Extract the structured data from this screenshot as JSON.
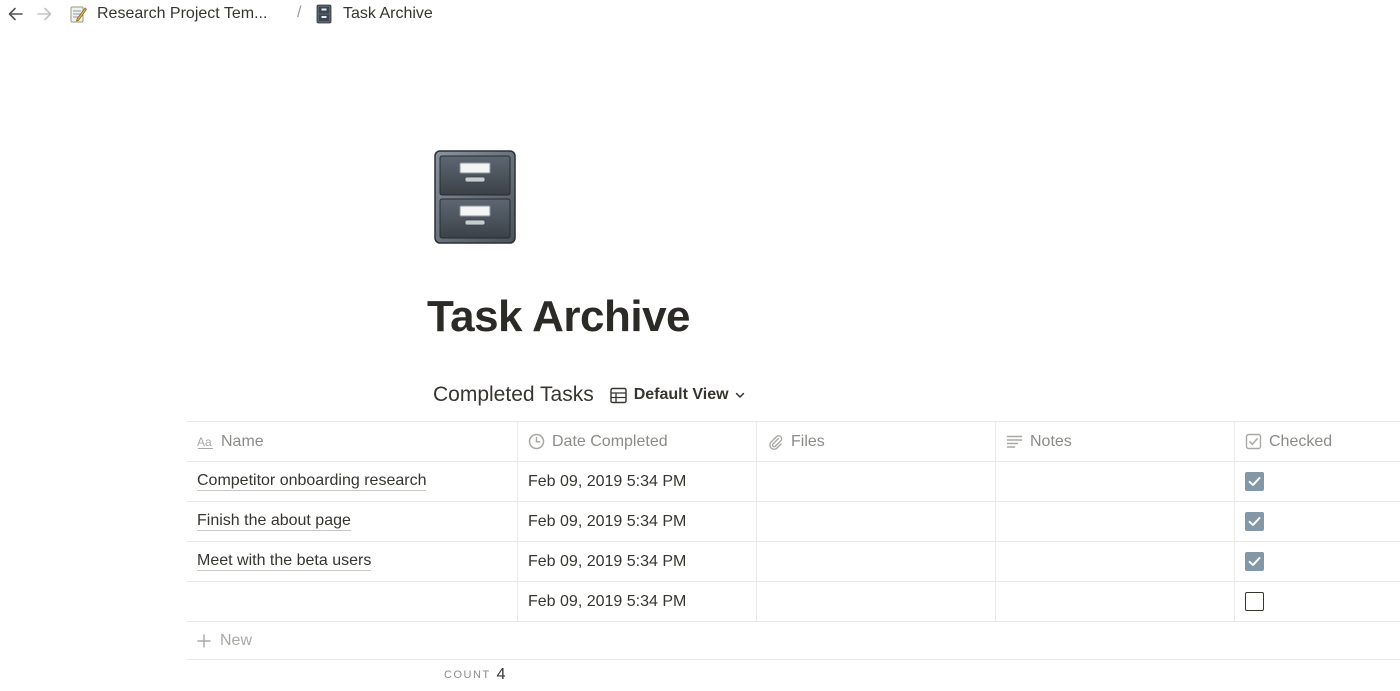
{
  "breadcrumb": {
    "items": [
      {
        "label": "Research Project Tem...",
        "icon": "memo-icon"
      },
      {
        "label": "Task Archive",
        "icon": "file-cabinet-icon"
      }
    ],
    "separator": "/"
  },
  "page": {
    "icon": "file-cabinet-icon",
    "title": "Task Archive"
  },
  "database": {
    "title": "Completed Tasks",
    "view_label": "Default View",
    "columns": [
      {
        "label": "Name",
        "icon": "text-aa-icon"
      },
      {
        "label": "Date Completed",
        "icon": "clock-icon"
      },
      {
        "label": "Files",
        "icon": "paperclip-icon"
      },
      {
        "label": "Notes",
        "icon": "lines-icon"
      },
      {
        "label": "Checked",
        "icon": "checkbox-icon"
      }
    ],
    "rows": [
      {
        "name": "Competitor onboarding research",
        "date": "Feb 09, 2019 5:34 PM",
        "files": "",
        "notes": "",
        "checked": true
      },
      {
        "name": "Finish the about page",
        "date": "Feb 09, 2019 5:34 PM",
        "files": "",
        "notes": "",
        "checked": true
      },
      {
        "name": "Meet with the beta users",
        "date": "Feb 09, 2019 5:34 PM",
        "files": "",
        "notes": "",
        "checked": true
      },
      {
        "name": "",
        "date": "Feb 09, 2019 5:34 PM",
        "files": "",
        "notes": "",
        "checked": false
      }
    ],
    "new_label": "New",
    "count_label": "COUNT",
    "count_value": "4"
  },
  "colors": {
    "text": "#37352f",
    "muted": "#8d8b87",
    "border": "#e9e9e7",
    "checkbox_fill": "#8397a7"
  }
}
